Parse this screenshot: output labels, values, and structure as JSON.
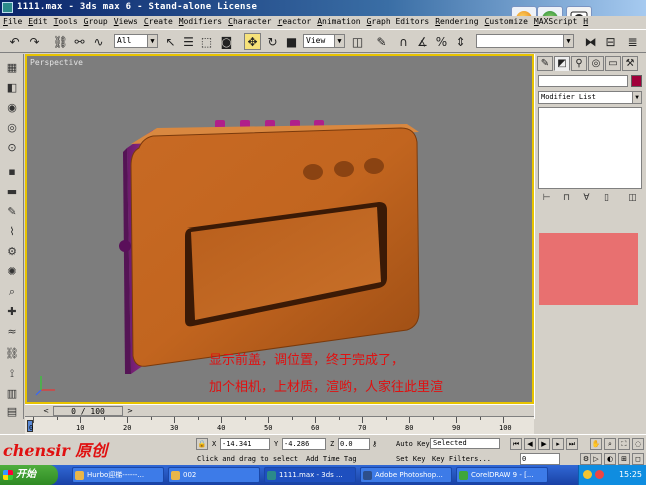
{
  "window": {
    "title": "1111.max - 3ds max 6 - Stand-alone License"
  },
  "menu": [
    "File",
    "Edit",
    "Tools",
    "Group",
    "Views",
    "Create",
    "Modifiers",
    "Character",
    "reactor",
    "Animation",
    "Graph Editors",
    "Rendering",
    "Customize",
    "MAXScript",
    "H"
  ],
  "toolbar": {
    "selection_filter": "All",
    "reference_coord": "View"
  },
  "viewport": {
    "label": "Perspective",
    "caption_line1": "显示前盖，调位置，终于完成了，",
    "caption_line2": "加个相机，上材质，渲哟，人家往此里渲"
  },
  "command_panel": {
    "modifier_list": "Modifier List",
    "object_color": "#a0003a",
    "swatch_color": "#e87070"
  },
  "timeline": {
    "frame_display": "0 / 100",
    "ticks": [
      "0",
      "10",
      "20",
      "30",
      "40",
      "50",
      "60",
      "70",
      "80",
      "90",
      "100"
    ]
  },
  "status": {
    "watermark": "chensir 原创",
    "x_label": "X",
    "x_value": "-14.341",
    "y_label": "Y",
    "y_value": "-4.286",
    "z_label": "Z",
    "z_value": "0.0",
    "prompt": "Click and drag to select",
    "add_time_tag": "Add Time Tag",
    "auto_key": "Auto Key",
    "set_key": "Set Key",
    "selected": "Selected",
    "key_filters": "Key Filters...",
    "frame": "0"
  },
  "taskbar": {
    "start": "开始",
    "tasks": [
      "Hurbo迎梯------...",
      "002",
      "1111.max - 3ds ...",
      "Adobe Photoshop...",
      "CorelDRAW 9 - [..."
    ],
    "clock": "15:25"
  }
}
